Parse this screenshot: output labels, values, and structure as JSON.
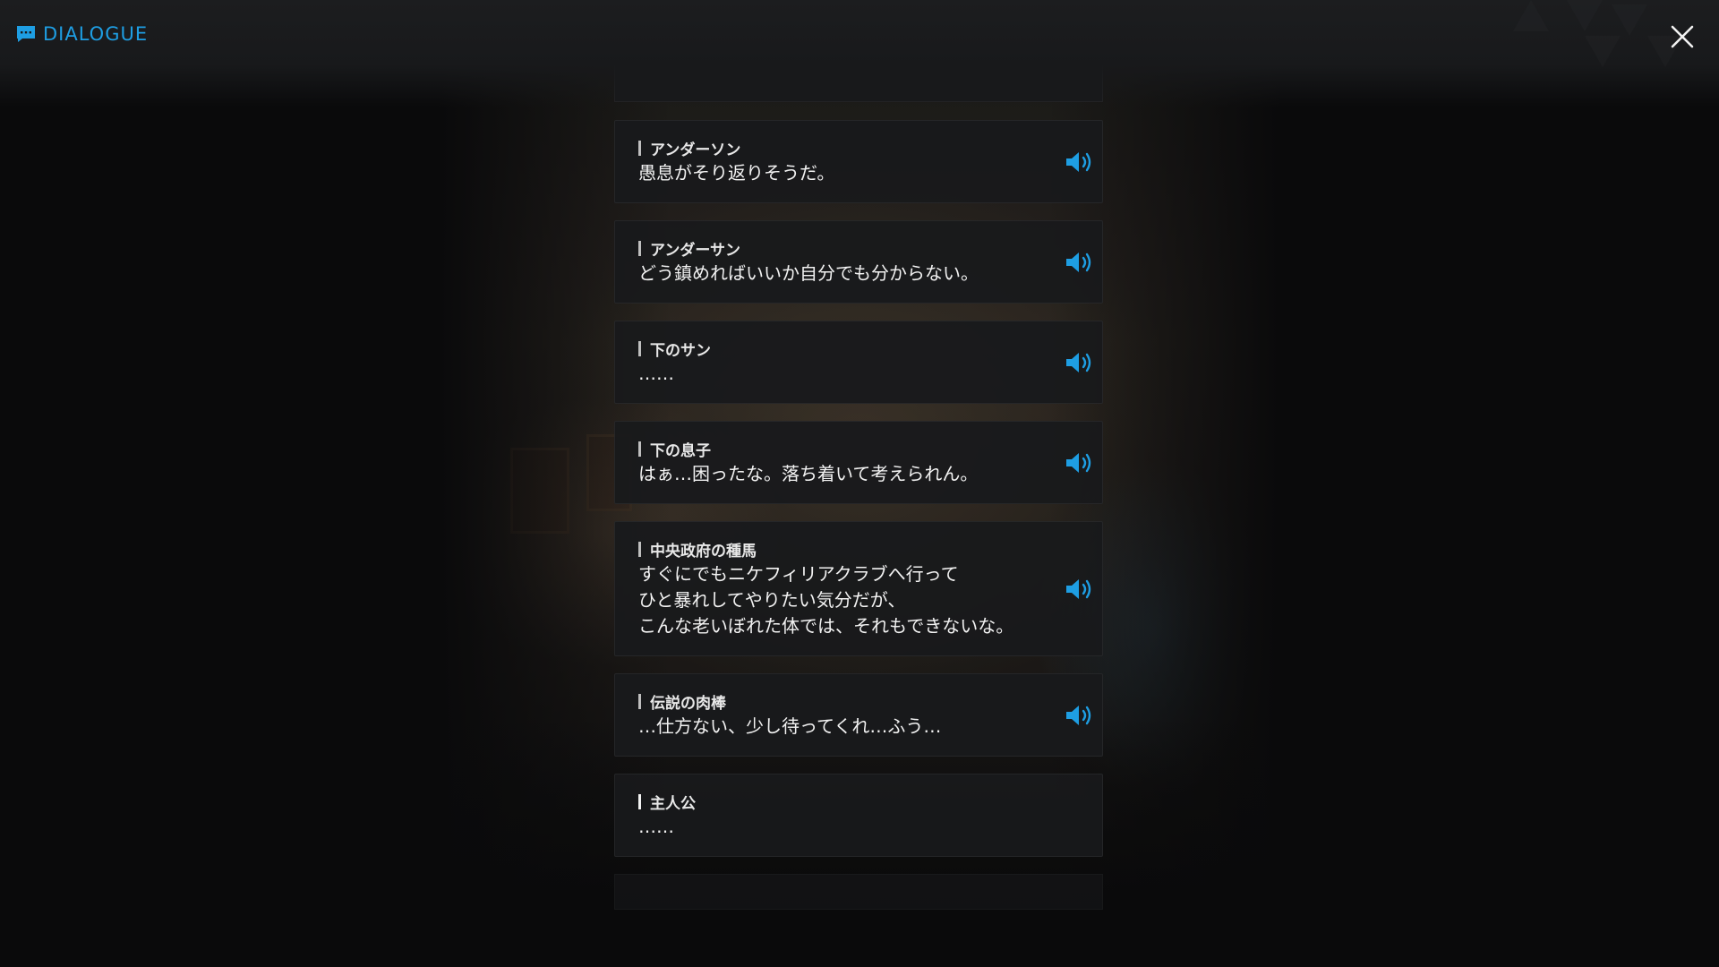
{
  "header": {
    "title": "DIALOGUE",
    "icon": "chat-bubble-icon",
    "accent_color": "#1e9ee3"
  },
  "close": {
    "icon": "close-icon"
  },
  "entries": [
    {
      "speaker": "アンダーソン",
      "line": "愚息がそり返りそうだ。",
      "voice": true
    },
    {
      "speaker": "アンダーサン",
      "line": "どう鎮めればいいか自分でも分からない。",
      "voice": true
    },
    {
      "speaker": "下のサン",
      "line": "……",
      "voice": true
    },
    {
      "speaker": "下の息子",
      "line": "はぁ…困ったな。落ち着いて考えられん。",
      "voice": true
    },
    {
      "speaker": "中央政府の種馬",
      "line": "すぐにでもニケフィリアクラブへ行って\nひと暴れしてやりたい気分だが、\nこんな老いぼれた体では、それもできないな。",
      "voice": true
    },
    {
      "speaker": "伝説の肉棒",
      "line": "…仕方ない、少し待ってくれ…ふう…",
      "voice": true
    },
    {
      "speaker": "主人公",
      "line": "……",
      "voice": false
    }
  ]
}
